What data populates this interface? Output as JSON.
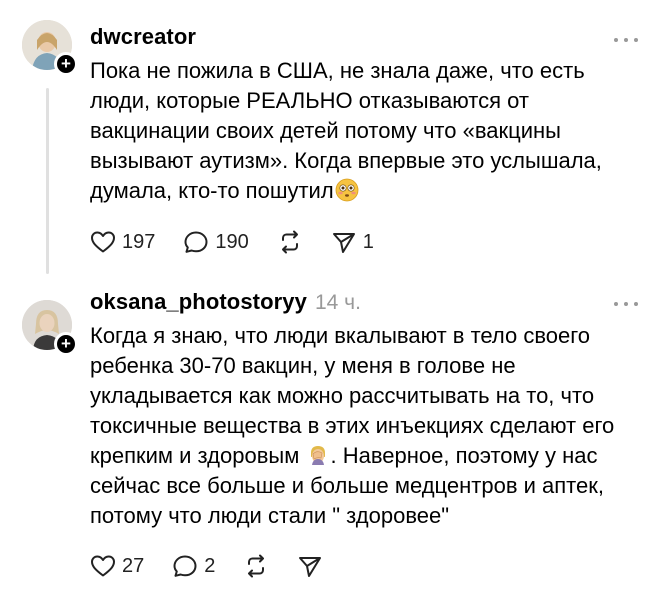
{
  "posts": [
    {
      "username": "dwcreator",
      "time": "",
      "text": "Пока не пожила в США, не знала даже, что есть люди, которые РЕАЛЬНО отказываются от вакцинации своих детей потому что «вакцины вызывают аутизм». Когда впервые это услышала, думала, кто-то пошутил",
      "emoji": "flushed-face-emoji",
      "likes": "197",
      "replies": "190",
      "reposts": "",
      "shares": "1"
    },
    {
      "username": "oksana_photostoryy",
      "time": "14 ч.",
      "text_before_emoji": "Когда я знаю, что люди вкалывают в тело своего ребенка 30-70 вакцин, у меня в голове не укладывается как можно рассчитывать на то, что токсичные вещества в этих инъекциях сделают его крепким и здоровым",
      "emoji": "face-palm-emoji",
      "text_after_emoji": ". Наверное, поэтому у нас сейчас все больше и больше медцентров и аптек, потому что люди стали \" здоровее\"",
      "likes": "27",
      "replies": "2",
      "reposts": "",
      "shares": ""
    }
  ],
  "follow_symbol": "+"
}
